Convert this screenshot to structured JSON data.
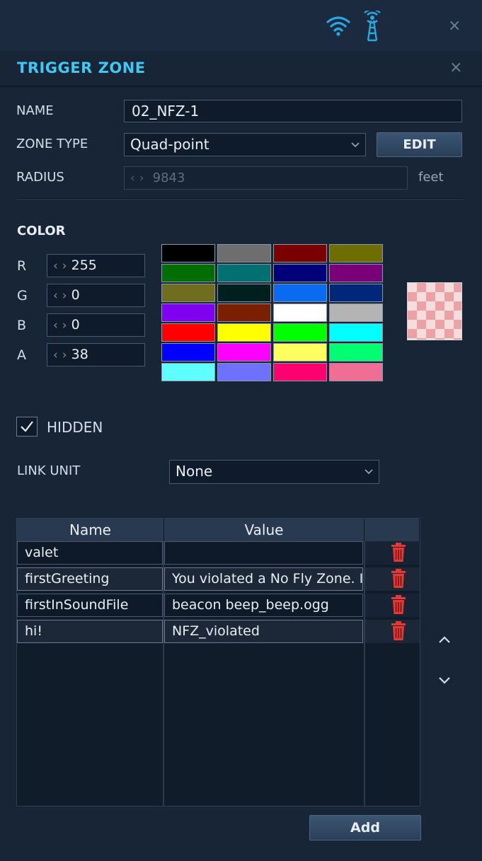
{
  "panel": {
    "title": "TRIGGER ZONE"
  },
  "icons": {
    "wifi": "wifi-icon",
    "tower": "broadcast-tower-icon",
    "close": "close-icon",
    "trash": "trash-icon"
  },
  "close_glyph": "×",
  "fields": {
    "name_label": "NAME",
    "name_value": "02_NFZ-1",
    "zone_type_label": "ZONE TYPE",
    "zone_type_value": "Quad-point",
    "edit_label": "EDIT",
    "radius_label": "RADIUS",
    "radius_value": "9843",
    "radius_unit": "feet"
  },
  "color": {
    "heading": "COLOR",
    "channels": [
      {
        "label": "R",
        "value": "255"
      },
      {
        "label": "G",
        "value": "0"
      },
      {
        "label": "B",
        "value": "0"
      },
      {
        "label": "A",
        "value": "38"
      }
    ],
    "palette": [
      "#000000",
      "#6e6e6e",
      "#7a0000",
      "#6e6e00",
      "#006e00",
      "#007070",
      "#00007a",
      "#7a007a",
      "#6e6e1e",
      "#002020",
      "#0a6af0",
      "#00287a",
      "#8000f0",
      "#7a2000",
      "#ffffff",
      "#b4b4b4",
      "#ff0000",
      "#ffff00",
      "#00ff00",
      "#00ffff",
      "#0000ff",
      "#ff00ff",
      "#ffff60",
      "#00ff70",
      "#60ffff",
      "#7070ff",
      "#ff0070",
      "#f06e96"
    ]
  },
  "hidden": {
    "label": "HIDDEN",
    "checked": true
  },
  "link_unit": {
    "label": "LINK UNIT",
    "value": "None"
  },
  "table": {
    "headers": [
      "Name",
      "Value"
    ],
    "rows": [
      {
        "name": "valet",
        "value": ""
      },
      {
        "name": "firstGreeting",
        "value": "You violated a No Fly Zone. I"
      },
      {
        "name": "firstInSoundFile",
        "value": "beacon beep_beep.ogg"
      },
      {
        "name": "hi!",
        "value": "NFZ_violated"
      }
    ]
  },
  "add_label": "Add"
}
